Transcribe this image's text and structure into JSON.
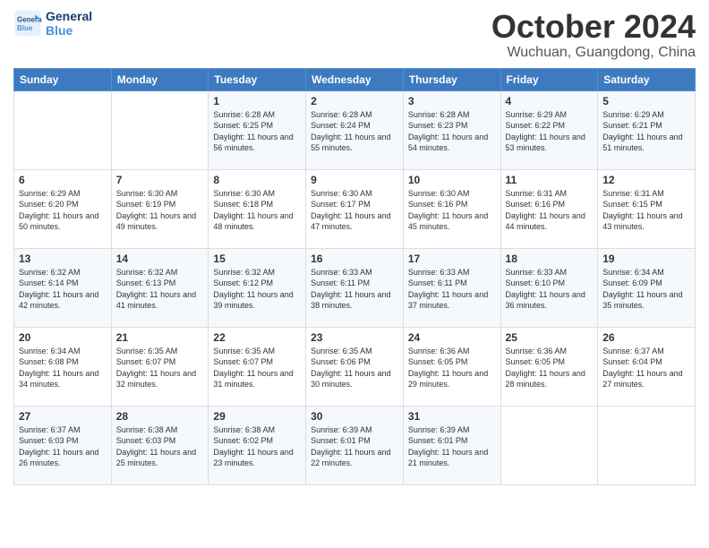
{
  "logo": {
    "line1": "General",
    "line2": "Blue"
  },
  "title": "October 2024",
  "location": "Wuchuan, Guangdong, China",
  "weekdays": [
    "Sunday",
    "Monday",
    "Tuesday",
    "Wednesday",
    "Thursday",
    "Friday",
    "Saturday"
  ],
  "weeks": [
    [
      {
        "day": "",
        "info": ""
      },
      {
        "day": "",
        "info": ""
      },
      {
        "day": "1",
        "info": "Sunrise: 6:28 AM\nSunset: 6:25 PM\nDaylight: 11 hours and 56 minutes."
      },
      {
        "day": "2",
        "info": "Sunrise: 6:28 AM\nSunset: 6:24 PM\nDaylight: 11 hours and 55 minutes."
      },
      {
        "day": "3",
        "info": "Sunrise: 6:28 AM\nSunset: 6:23 PM\nDaylight: 11 hours and 54 minutes."
      },
      {
        "day": "4",
        "info": "Sunrise: 6:29 AM\nSunset: 6:22 PM\nDaylight: 11 hours and 53 minutes."
      },
      {
        "day": "5",
        "info": "Sunrise: 6:29 AM\nSunset: 6:21 PM\nDaylight: 11 hours and 51 minutes."
      }
    ],
    [
      {
        "day": "6",
        "info": "Sunrise: 6:29 AM\nSunset: 6:20 PM\nDaylight: 11 hours and 50 minutes."
      },
      {
        "day": "7",
        "info": "Sunrise: 6:30 AM\nSunset: 6:19 PM\nDaylight: 11 hours and 49 minutes."
      },
      {
        "day": "8",
        "info": "Sunrise: 6:30 AM\nSunset: 6:18 PM\nDaylight: 11 hours and 48 minutes."
      },
      {
        "day": "9",
        "info": "Sunrise: 6:30 AM\nSunset: 6:17 PM\nDaylight: 11 hours and 47 minutes."
      },
      {
        "day": "10",
        "info": "Sunrise: 6:30 AM\nSunset: 6:16 PM\nDaylight: 11 hours and 45 minutes."
      },
      {
        "day": "11",
        "info": "Sunrise: 6:31 AM\nSunset: 6:16 PM\nDaylight: 11 hours and 44 minutes."
      },
      {
        "day": "12",
        "info": "Sunrise: 6:31 AM\nSunset: 6:15 PM\nDaylight: 11 hours and 43 minutes."
      }
    ],
    [
      {
        "day": "13",
        "info": "Sunrise: 6:32 AM\nSunset: 6:14 PM\nDaylight: 11 hours and 42 minutes."
      },
      {
        "day": "14",
        "info": "Sunrise: 6:32 AM\nSunset: 6:13 PM\nDaylight: 11 hours and 41 minutes."
      },
      {
        "day": "15",
        "info": "Sunrise: 6:32 AM\nSunset: 6:12 PM\nDaylight: 11 hours and 39 minutes."
      },
      {
        "day": "16",
        "info": "Sunrise: 6:33 AM\nSunset: 6:11 PM\nDaylight: 11 hours and 38 minutes."
      },
      {
        "day": "17",
        "info": "Sunrise: 6:33 AM\nSunset: 6:11 PM\nDaylight: 11 hours and 37 minutes."
      },
      {
        "day": "18",
        "info": "Sunrise: 6:33 AM\nSunset: 6:10 PM\nDaylight: 11 hours and 36 minutes."
      },
      {
        "day": "19",
        "info": "Sunrise: 6:34 AM\nSunset: 6:09 PM\nDaylight: 11 hours and 35 minutes."
      }
    ],
    [
      {
        "day": "20",
        "info": "Sunrise: 6:34 AM\nSunset: 6:08 PM\nDaylight: 11 hours and 34 minutes."
      },
      {
        "day": "21",
        "info": "Sunrise: 6:35 AM\nSunset: 6:07 PM\nDaylight: 11 hours and 32 minutes."
      },
      {
        "day": "22",
        "info": "Sunrise: 6:35 AM\nSunset: 6:07 PM\nDaylight: 11 hours and 31 minutes."
      },
      {
        "day": "23",
        "info": "Sunrise: 6:35 AM\nSunset: 6:06 PM\nDaylight: 11 hours and 30 minutes."
      },
      {
        "day": "24",
        "info": "Sunrise: 6:36 AM\nSunset: 6:05 PM\nDaylight: 11 hours and 29 minutes."
      },
      {
        "day": "25",
        "info": "Sunrise: 6:36 AM\nSunset: 6:05 PM\nDaylight: 11 hours and 28 minutes."
      },
      {
        "day": "26",
        "info": "Sunrise: 6:37 AM\nSunset: 6:04 PM\nDaylight: 11 hours and 27 minutes."
      }
    ],
    [
      {
        "day": "27",
        "info": "Sunrise: 6:37 AM\nSunset: 6:03 PM\nDaylight: 11 hours and 26 minutes."
      },
      {
        "day": "28",
        "info": "Sunrise: 6:38 AM\nSunset: 6:03 PM\nDaylight: 11 hours and 25 minutes."
      },
      {
        "day": "29",
        "info": "Sunrise: 6:38 AM\nSunset: 6:02 PM\nDaylight: 11 hours and 23 minutes."
      },
      {
        "day": "30",
        "info": "Sunrise: 6:39 AM\nSunset: 6:01 PM\nDaylight: 11 hours and 22 minutes."
      },
      {
        "day": "31",
        "info": "Sunrise: 6:39 AM\nSunset: 6:01 PM\nDaylight: 11 hours and 21 minutes."
      },
      {
        "day": "",
        "info": ""
      },
      {
        "day": "",
        "info": ""
      }
    ]
  ]
}
